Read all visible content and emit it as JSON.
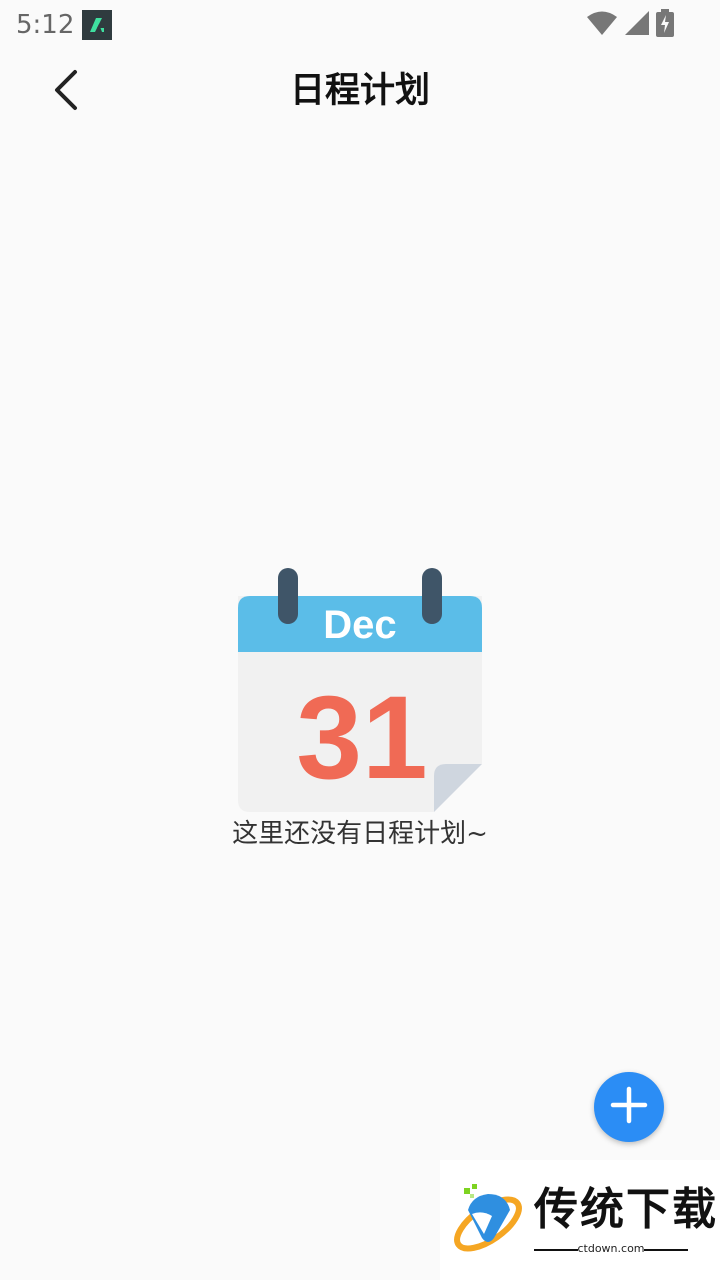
{
  "status_bar": {
    "time": "5:12",
    "icons": [
      "app-notification-icon",
      "wifi-icon",
      "signal-icon",
      "battery-charging-icon"
    ]
  },
  "header": {
    "title": "日程计划",
    "back_icon": "chevron-left-icon"
  },
  "empty_state": {
    "calendar_month": "Dec",
    "calendar_day": "31",
    "message": "这里还没有日程计划~"
  },
  "fab": {
    "icon": "plus-icon",
    "color": "#2b8df5"
  },
  "watermark": {
    "title": "传统下载",
    "subtitle": "ctdown.com"
  },
  "colors": {
    "calendar_header": "#5bbde8",
    "calendar_rings": "#3f5568",
    "calendar_day": "#f06a55",
    "calendar_body": "#f1f1f1"
  }
}
